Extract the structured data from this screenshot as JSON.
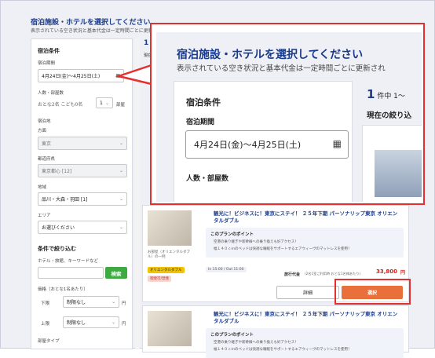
{
  "page": {
    "title": "宿泊施設・ホテルを選択してください",
    "subtitle": "表示されている空き状況と基本代金は一定時間ごとに更新されます"
  },
  "sidebar": {
    "conditions_heading": "宿泊条件",
    "period_label": "宿泊期間",
    "period_value": "4月24日(金)〜4月25日(土)",
    "people_label": "人数・部屋数",
    "people_value": "おとな2名 こども0名",
    "rooms_value": "1",
    "rooms_unit": "部屋",
    "area_heading": "宿泊地",
    "region_label": "方面",
    "region_value": "東京",
    "pref_label": "都道府県",
    "pref_value": "東京都心 [12]",
    "district_label": "地域",
    "district_value": "品川・大森・羽田 [1]",
    "area_label": "エリア",
    "area_value": "お選びください",
    "filter_heading": "条件で絞り込む",
    "keyword_label": "ホテル・旅館、キーワードなど",
    "search_button": "検索",
    "price_label": "価格（おとな1名あたり）",
    "price_min_label": "下限",
    "price_min_value": "制限なし",
    "price_max_label": "上限",
    "price_max_value": "制限なし",
    "yen": "円",
    "room_type_label": "部屋タイプ"
  },
  "callout": {
    "title": "宿泊施設・ホテルを選択してください",
    "subtitle": "表示されている空き状況と基本代金は一定時間ごとに更新され",
    "conditions_heading": "宿泊条件",
    "period_label": "宿泊期間",
    "period_value": "4月24日(金)〜4月25日(土)",
    "people_label": "人数・部屋数",
    "count_num": "1",
    "count_text": "件中 1〜",
    "filter_text": "現在の絞り込"
  },
  "results": {
    "count_num": "1",
    "current_label": "現在",
    "items": [
      {
        "name": "観光に！ビジネスに！東京にステイ！ ２５年下期 パーソナリップ東京 オリエンタルダブル",
        "thumb_caption": "お部屋（オリエンタルダブル）の一例",
        "point_title": "このプランのポイント",
        "point_line1": "空港の乗り継ぎや新幹線への乗り換えも好アクセス！",
        "point_line2": "幅１４０ｃｍのベッドは快適な睡眠をサポートするエアウィーヴのマットレスを使用！",
        "tag1": "オリエンタルダブル",
        "tag2": "喫煙可/禁煙",
        "checkin": "In 15:00 / Out 11:00",
        "price_label": "旅行代金",
        "price_note": "(2名1室ご利用時 おとな1名様あたり)",
        "price": "33,800",
        "yen": "円",
        "detail_button": "詳細",
        "select_button": "選択"
      },
      {
        "name": "観光に！ビジネスに！東京にステイ！ ２５年下期 パーソナリップ東京 オリエンタルダブル",
        "point_title": "このプランのポイント",
        "point_line1": "空港の乗り継ぎや新幹線への乗り換えも好アクセス！",
        "point_line2": "幅１４０ｃｍのベッドは快適な睡眠をサポートするエアウィーヴのマットレスを使用！"
      }
    ]
  },
  "colors": {
    "accent_blue": "#1a3a8a",
    "highlight_red": "#e3302f",
    "search_green": "#3eaa42",
    "select_orange": "#e9703a",
    "price_red": "#d81b1b"
  }
}
